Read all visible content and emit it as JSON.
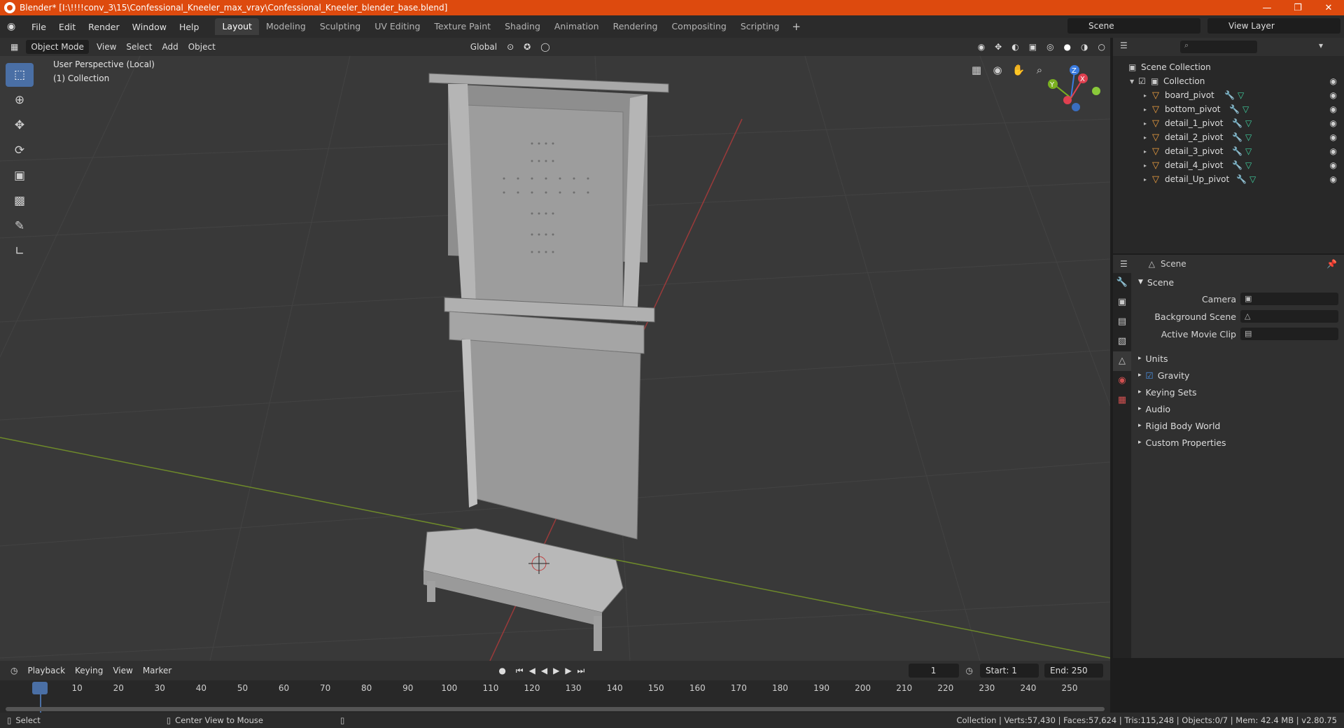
{
  "window": {
    "title": "Blender* [I:\\!!!!conv_3\\15\\Confessional_Kneeler_max_vray\\Confessional_Kneeler_blender_base.blend]"
  },
  "menu": [
    "File",
    "Edit",
    "Render",
    "Window",
    "Help"
  ],
  "workspaces": [
    "Layout",
    "Modeling",
    "Sculpting",
    "UV Editing",
    "Texture Paint",
    "Shading",
    "Animation",
    "Rendering",
    "Compositing",
    "Scripting"
  ],
  "scene": "Scene",
  "view_layer": "View Layer",
  "viewport_header": {
    "mode": "Object Mode",
    "view": "View",
    "select": "Select",
    "add": "Add",
    "object": "Object",
    "transform": "Global"
  },
  "viewport": {
    "perspective": "User Perspective (Local)",
    "collection": "(1) Collection"
  },
  "outliner": {
    "root": "Scene Collection",
    "collection": "Collection",
    "objects": [
      "board_pivot",
      "bottom_pivot",
      "detail_1_pivot",
      "detail_2_pivot",
      "detail_3_pivot",
      "detail_4_pivot",
      "detail_Up_pivot"
    ]
  },
  "properties": {
    "context": "Scene",
    "panel": "Scene",
    "camera_label": "Camera",
    "bg_scene_label": "Background Scene",
    "movie_clip_label": "Active Movie Clip",
    "sections": [
      "Units",
      "Gravity",
      "Keying Sets",
      "Audio",
      "Rigid Body World",
      "Custom Properties"
    ]
  },
  "timeline": {
    "playback": "Playback",
    "keying": "Keying",
    "view": "View",
    "marker": "Marker",
    "current_frame": "1",
    "start_label": "Start:",
    "start": "1",
    "end_label": "End:",
    "end": "250",
    "ticks": [
      "1",
      "10",
      "20",
      "30",
      "40",
      "50",
      "60",
      "70",
      "80",
      "90",
      "100",
      "110",
      "120",
      "130",
      "140",
      "150",
      "160",
      "170",
      "180",
      "190",
      "200",
      "210",
      "220",
      "230",
      "240",
      "250"
    ]
  },
  "statusbar": {
    "left": "Select",
    "middle": "Center View to Mouse",
    "right": "Collection | Verts:57,430 | Faces:57,624 | Tris:115,248 | Objects:0/7 | Mem: 42.4 MB | v2.80.75"
  },
  "colors": {
    "titlebar": "#dd4a0e",
    "accent": "#4a6fa5",
    "x_axis": "#e04050",
    "y_axis": "#7ab020",
    "z_axis": "#3a7be0"
  }
}
